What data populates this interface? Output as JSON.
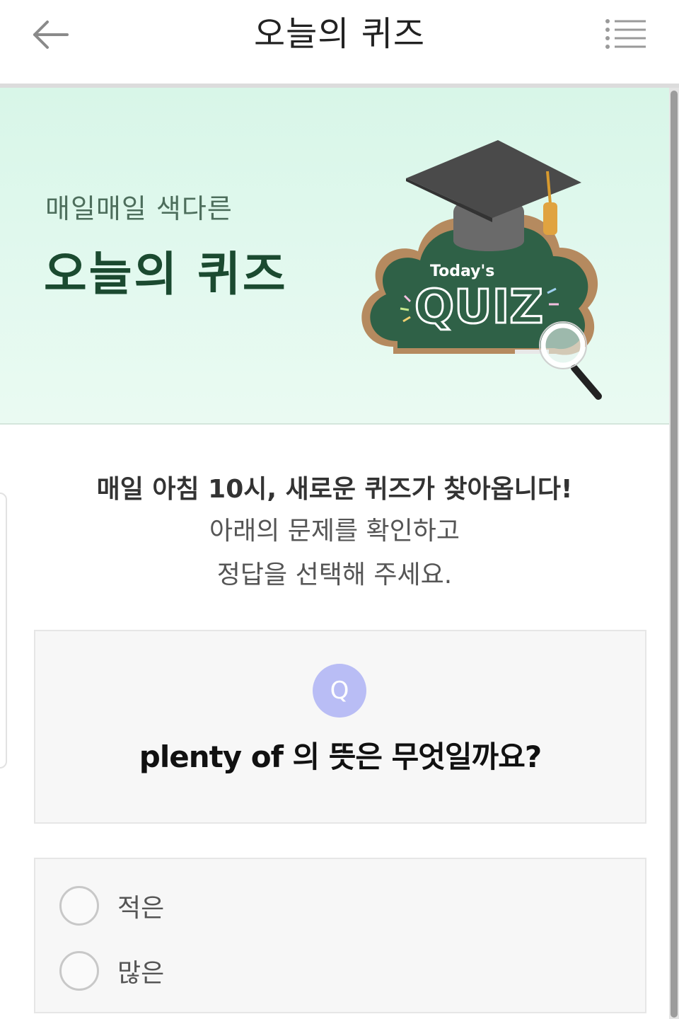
{
  "header": {
    "title": "오늘의 퀴즈",
    "back_icon": "arrow-left-icon",
    "menu_icon": "list-menu-icon"
  },
  "banner": {
    "subtitle": "매일매일 색다른",
    "title": "오늘의 퀴즈",
    "illustration": {
      "small_text": "Today's",
      "big_text": "QUIZ",
      "icons": [
        "graduation-cap-icon",
        "chalkboard-cloud-icon",
        "magnifier-icon"
      ]
    },
    "background_color": "#dff8ec"
  },
  "intro": {
    "line1": "매일 아침 10시, 새로운 퀴즈가 찾아옵니다!",
    "line2": "아래의 문제를 확인하고",
    "line3": "정답을 선택해 주세요."
  },
  "question": {
    "badge": "Q",
    "badge_color": "#b9bdf5",
    "text": "plenty of 의 뜻은 무엇일까요?"
  },
  "options": [
    {
      "label": "적은",
      "selected": false
    },
    {
      "label": "많은",
      "selected": false
    }
  ]
}
